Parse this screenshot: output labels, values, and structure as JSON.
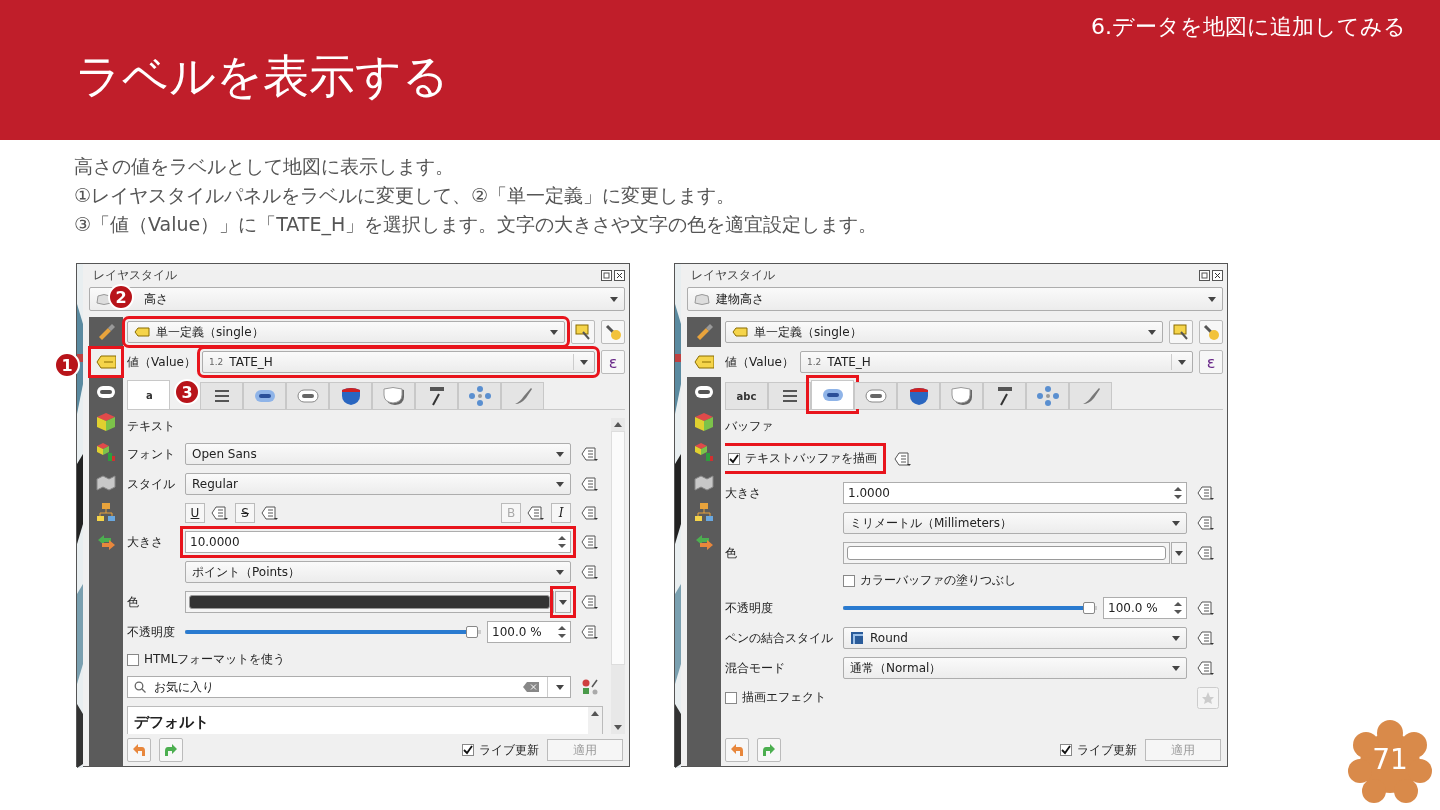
{
  "header": {
    "section": "6.データを地図に追加してみる",
    "title": "ラベルを表示する"
  },
  "intro": [
    "高さの値をラベルとして地図に表示します。",
    "①レイヤスタイルパネルをラベルに変更して、②「単一定義」に変更します。",
    "③「値（Value）」に「TATE_H」を選択します。文字の大きさや文字の色を適宜設定します。"
  ],
  "panels": [
    {
      "title": "レイヤスタイル",
      "layer": "高さ",
      "scrollbar": true,
      "callouts": [
        {
          "number": "2"
        },
        {
          "number": "1"
        },
        {
          "number": "3"
        }
      ],
      "sidebar": [
        {
          "selected": false
        },
        {
          "selected": true,
          "highlighted": true
        },
        {
          "selected": false
        },
        {
          "selected": false
        },
        {
          "selected": false
        },
        {
          "selected": false
        },
        {
          "selected": false
        },
        {
          "selected": false
        }
      ],
      "renderer": {
        "value": "単一定義（single）",
        "highlighted": true
      },
      "value": {
        "label": "値（Value）",
        "prefix": "1.2",
        "field": "TATE_H",
        "highlighted": true
      },
      "expression": "ε",
      "tabs": [
        {
          "label": "a",
          "selected": true
        },
        {
          "selected": false
        },
        {
          "selected": false
        },
        {
          "selected": false
        },
        {
          "selected": false
        },
        {
          "selected": false
        },
        {
          "selected": false
        },
        {
          "selected": false
        },
        {
          "selected": false
        }
      ],
      "rows": [
        {
          "kind": "heading",
          "text": "テキスト"
        },
        {
          "kind": "combo",
          "label": "フォント",
          "value": "Open Sans"
        },
        {
          "kind": "combo",
          "label": "スタイル",
          "value": "Regular"
        },
        {
          "kind": "format",
          "buttons": [
            {
              "text": "U"
            },
            {
              "text": "S"
            },
            {
              "text": "B"
            },
            {
              "text": "I"
            }
          ]
        },
        {
          "kind": "spin",
          "label": "大きさ",
          "value": "10.0000",
          "highlighted": true
        },
        {
          "kind": "combo",
          "value": "ポイント（Points）"
        },
        {
          "kind": "color",
          "label": "色",
          "color": "#333333",
          "arrow_highlighted": true
        },
        {
          "kind": "slider",
          "label": "不透明度",
          "level": 0.97,
          "value": "100.0 %"
        },
        {
          "kind": "checkbox",
          "label": "HTMLフォーマットを使う",
          "checked": false
        },
        {
          "kind": "search",
          "value": "お気に入り"
        },
        {
          "kind": "list",
          "heading": "デフォルト"
        }
      ],
      "footer": {
        "live_update": {
          "label": "ライブ更新",
          "checked": true
        },
        "apply": {
          "label": "適用",
          "disabled": true
        }
      }
    },
    {
      "title": "レイヤスタイル",
      "layer": "建物高さ",
      "sidebar": [
        {
          "selected": false
        },
        {
          "selected": true
        },
        {
          "selected": false
        },
        {
          "selected": false
        },
        {
          "selected": false
        },
        {
          "selected": false
        },
        {
          "selected": false
        },
        {
          "selected": false
        }
      ],
      "renderer": {
        "value": "単一定義（single）"
      },
      "value": {
        "label": "値（Value）",
        "prefix": "1.2",
        "field": "TATE_H"
      },
      "expression": "ε",
      "tabs": [
        {
          "label": "abc",
          "selected": false
        },
        {
          "selected": false
        },
        {
          "selected": true,
          "highlighted": true
        },
        {
          "selected": false
        },
        {
          "selected": false
        },
        {
          "selected": false
        },
        {
          "selected": false
        },
        {
          "selected": false
        },
        {
          "selected": false
        }
      ],
      "rows": [
        {
          "kind": "heading",
          "text": "バッファ"
        },
        {
          "kind": "checkbox",
          "label": "テキストバッファを描画",
          "checked": true,
          "highlighted": true,
          "data_defined": true
        },
        {
          "kind": "spin",
          "label": "大きさ",
          "value": "1.0000"
        },
        {
          "kind": "combo",
          "value": "ミリメートル（Millimeters）"
        },
        {
          "kind": "color",
          "label": "色",
          "color": "#ffffff"
        },
        {
          "kind": "subcheck",
          "label": "カラーバッファの塗りつぶし",
          "checked": false
        },
        {
          "kind": "slider",
          "label": "不透明度",
          "level": 0.97,
          "value": "100.0 %"
        },
        {
          "kind": "icon_combo",
          "label": "ペンの結合スタイル",
          "value": "Round"
        },
        {
          "kind": "combo",
          "label": "混合モード",
          "value": "通常（Normal）"
        },
        {
          "kind": "effects",
          "label": "描画エフェクト",
          "checked": false
        }
      ],
      "footer": {
        "live_update": {
          "label": "ライブ更新",
          "checked": true
        },
        "apply": {
          "label": "適用",
          "disabled": true
        }
      }
    }
  ],
  "page_number": "71"
}
